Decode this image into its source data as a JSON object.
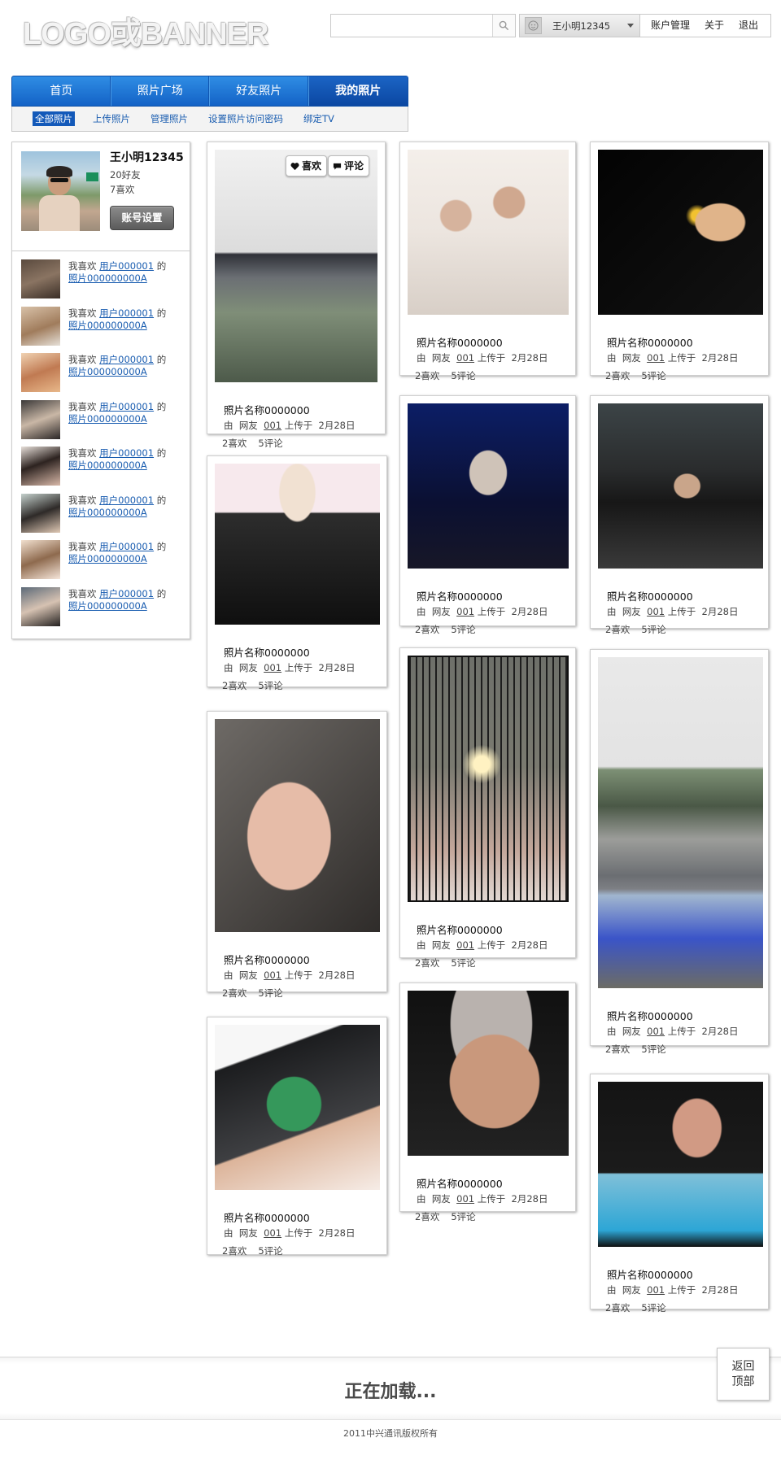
{
  "header": {
    "logo": "LOGO或BANNER",
    "search_placeholder": "",
    "username": "王小明12345",
    "links": [
      "账户管理",
      "关于",
      "退出"
    ]
  },
  "nav": {
    "tabs": [
      "首页",
      "照片广场",
      "好友照片",
      "我的照片"
    ],
    "active": "我的照片",
    "subtabs": [
      "全部照片",
      "上传照片",
      "管理照片",
      "设置照片访问密码",
      "绑定TV"
    ],
    "active_sub": "全部照片"
  },
  "profile": {
    "name": "王小明12345",
    "friends": "20好友",
    "likes": "7喜欢",
    "settings_button": "账号设置"
  },
  "activity": [
    {
      "prefix": "我喜欢",
      "user": "用户000001",
      "of": "的",
      "photo": "照片000000000A"
    },
    {
      "prefix": "我喜欢",
      "user": "用户000001",
      "of": "的",
      "photo": "照片000000000A"
    },
    {
      "prefix": "我喜欢",
      "user": "用户000001",
      "of": "的",
      "photo": "照片000000000A"
    },
    {
      "prefix": "我喜欢",
      "user": "用户000001",
      "of": "的",
      "photo": "照片000000000A"
    },
    {
      "prefix": "我喜欢",
      "user": "用户000001",
      "of": "的",
      "photo": "照片000000000A"
    },
    {
      "prefix": "我喜欢",
      "user": "用户000001",
      "of": "的",
      "photo": "照片000000000A"
    },
    {
      "prefix": "我喜欢",
      "user": "用户000001",
      "of": "的",
      "photo": "照片000000000A"
    },
    {
      "prefix": "我喜欢",
      "user": "用户000001",
      "of": "的",
      "photo": "照片000000000A"
    }
  ],
  "card_overlay": {
    "like": "喜欢",
    "comment": "评论"
  },
  "photo": {
    "title": "照片名称0000000",
    "by": "由",
    "friend": "网友",
    "user_id": "001",
    "uploaded": "上传于",
    "date": "2月28日",
    "likes": "2喜欢",
    "comments": "5评论"
  },
  "footer": {
    "loading": "正在加载...",
    "back_top_line1": "返回",
    "back_top_line2": "顶部",
    "copyright": "2011中兴通讯版权所有"
  }
}
